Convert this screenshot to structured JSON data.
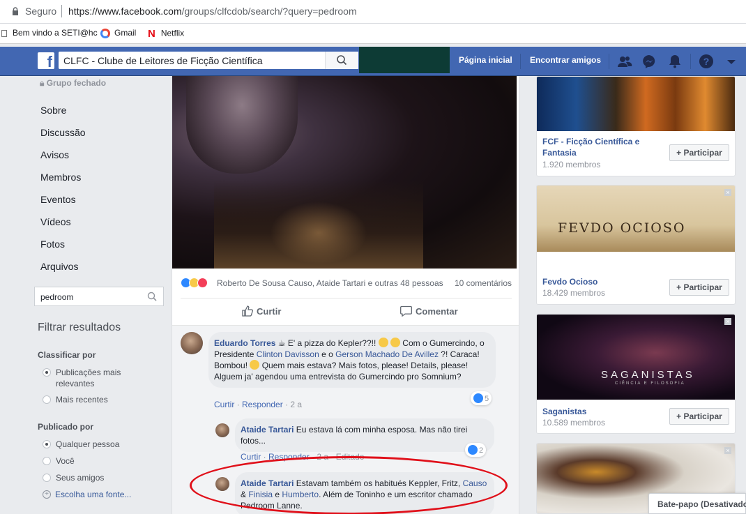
{
  "browser": {
    "secure_label": "Seguro",
    "url_host": "https://www.facebook.com",
    "url_path": "/groups/clfcdob/search/?query=pedroom",
    "bookmarks": [
      "Bem vindo a SETI@hc",
      "Gmail",
      "Netflix"
    ]
  },
  "header": {
    "search_value": "CLFC - Clube de Leitores de Ficção Científica",
    "nav": [
      "Página inicial",
      "Encontrar amigos"
    ],
    "icons": [
      "friends-icon",
      "messenger-icon",
      "notifications-icon",
      "help-icon",
      "dropdown-icon"
    ]
  },
  "sidebar": {
    "group_type": "Grupo fechado",
    "items": [
      "Sobre",
      "Discussão",
      "Avisos",
      "Membros",
      "Eventos",
      "Vídeos",
      "Fotos",
      "Arquivos"
    ],
    "search_value": "pedroom",
    "filter_title": "Filtrar resultados",
    "sort_label": "Classificar por",
    "sort_options": [
      "Publicações mais relevantes",
      "Mais recentes"
    ],
    "posted_by_label": "Publicado por",
    "posted_by_options": [
      "Qualquer pessoa",
      "Você",
      "Seus amigos"
    ],
    "choose_source": "Escolha uma fonte..."
  },
  "post": {
    "reaction_names": "Roberto De Sousa Causo, Ataide Tartari e outras 48 pessoas",
    "comments_count": "10 comentários",
    "like_label": "Curtir",
    "comment_label": "Comentar"
  },
  "comments": [
    {
      "author": "Eduardo Torres",
      "t1": " E' a pizza do Kepler??!! ",
      "t2": " Com o Gumercindo, o Presidente ",
      "link1": "Clinton Davisson",
      "t3": " e o ",
      "link2": "Gerson Machado De Avillez",
      "t4": " ?! Caraca! Bombou! ",
      "t5": " Quem mais estava? Mais fotos, please! Details, please! Alguem ja' agendou uma entrevista do Gumercindo pro Somnium?",
      "meta_like": "Curtir",
      "meta_reply": "Responder",
      "meta_time": "2 a",
      "likes": "5"
    },
    {
      "author": "Ataide Tartari",
      "text": " Eu estava lá com minha esposa. Mas não tirei fotos...",
      "meta_like": "Curtir",
      "meta_reply": "Responder",
      "meta_time": "2 a",
      "meta_edited": "Editado",
      "likes": "2"
    },
    {
      "author": "Ataide Tartari",
      "t1": " Estavam também os habitués Keppler, Fritz, ",
      "link1": "Causo",
      "t2": " & ",
      "link2": "Finisia",
      "t3": " e ",
      "link3": "Humberto",
      "t4": ". Além de Toninho e um escritor chamado Pedroom Lanne."
    }
  ],
  "suggested_groups": [
    {
      "name": "FCF - Ficção Científica e Fantasia",
      "members": "1.920 membros",
      "join": "Participar"
    },
    {
      "name": "Fevdo Ocioso",
      "members": "18.429 membros",
      "join": "Participar",
      "banner_text": "FEVDO OCIOSO"
    },
    {
      "name": "Saganistas",
      "members": "10.589 membros",
      "join": "Participar",
      "banner_text": "SAGANISTAS",
      "banner_sub": "CIÊNCIA E FILOSOFIA"
    }
  ],
  "chat": {
    "label": "Bate-papo (Desativado)"
  },
  "colors": {
    "fb_blue": "#4267b2",
    "link": "#385898",
    "highlight_ring": "#e0101a"
  }
}
